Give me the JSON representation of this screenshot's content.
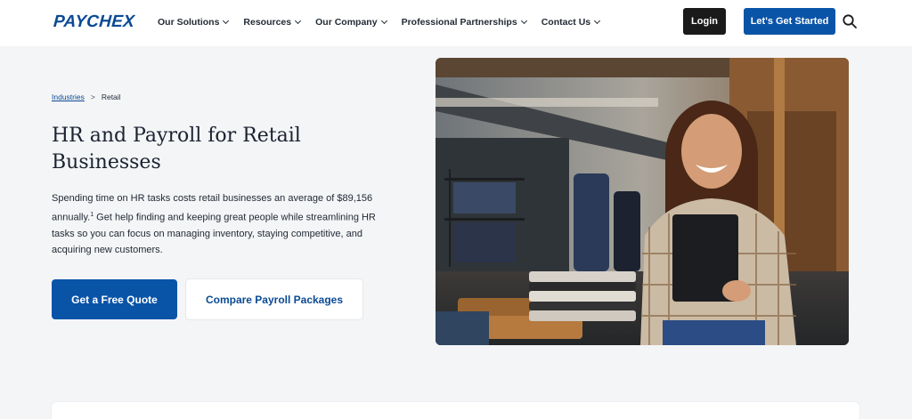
{
  "header": {
    "logo": "PAYCHEX",
    "nav": [
      {
        "label": "Our Solutions"
      },
      {
        "label": "Resources"
      },
      {
        "label": "Our Company"
      },
      {
        "label": "Professional Partnerships"
      },
      {
        "label": "Contact Us"
      }
    ],
    "login_label": "Login",
    "start_label": "Let's Get Started",
    "search_icon": "search-icon"
  },
  "breadcrumb": {
    "parent": "Industries",
    "separator": ">",
    "current": "Retail"
  },
  "hero": {
    "title": "HR and Payroll for Retail Businesses",
    "text_part1": "Spending time on HR tasks costs retail businesses an average of $89,156 annually.",
    "footnote": "1",
    "text_part2": " Get help finding and keeping great people while streamlining HR tasks so you can focus on managing inventory, staying competitive, and acquiring new customers.",
    "primary_cta": "Get a Free Quote",
    "secondary_cta": "Compare Payroll Packages"
  },
  "colors": {
    "brand_blue": "#0a54a8",
    "dark_button": "#1a1a1a",
    "page_bg": "#f4f5f7"
  }
}
